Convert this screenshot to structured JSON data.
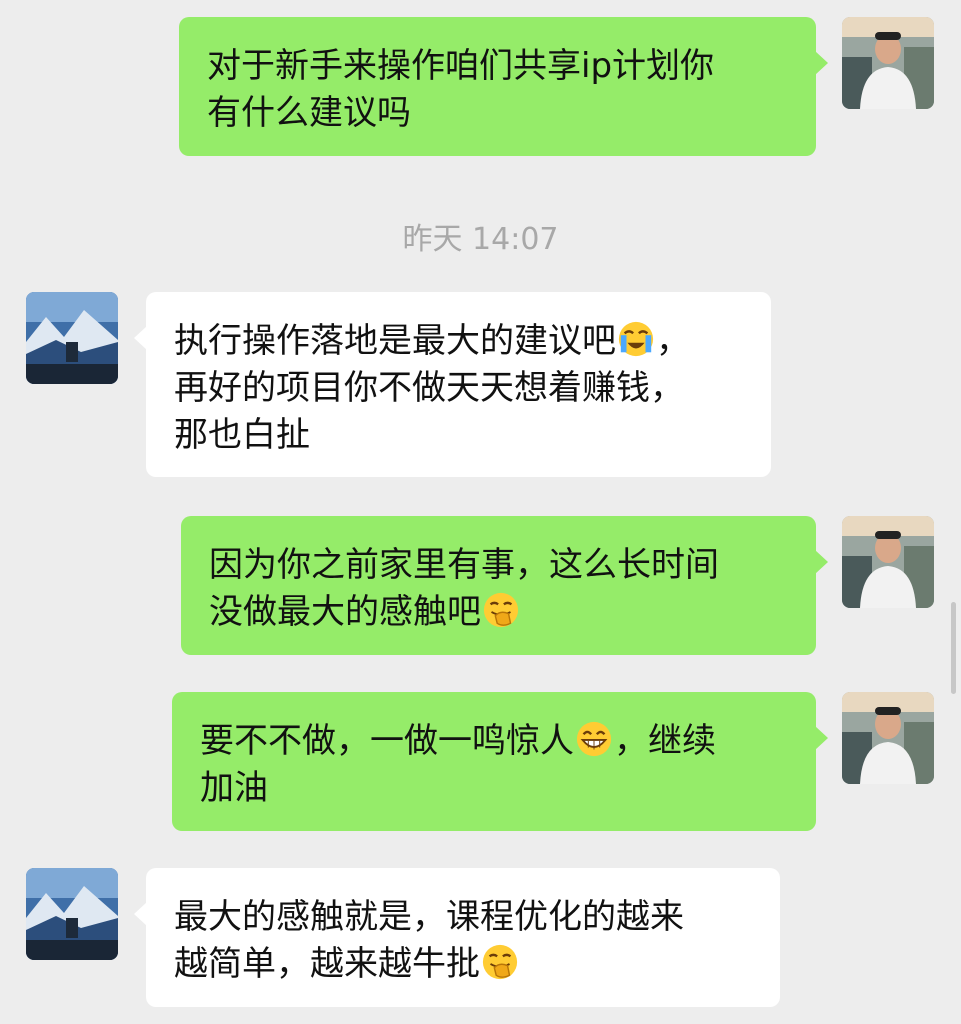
{
  "timestamp": "昨天 14:07",
  "messages": [
    {
      "side": "right",
      "lines": [
        "对于新手来操作咱们共享ip计划你",
        "有什么建议吗"
      ]
    },
    {
      "side": "left",
      "lines": [
        "执行操作落地是最大的建议吧",
        "，",
        "再好的项目你不做天天想着赚钱，",
        "那也白扯"
      ],
      "emoji": "loudly-crying-face"
    },
    {
      "side": "right",
      "lines": [
        "因为你之前家里有事，这么长时间",
        "没做最大的感触吧"
      ],
      "emoji": "face-with-hand-over-mouth"
    },
    {
      "side": "right",
      "lines": [
        "要不不做，一做一鸣惊人",
        "，继续",
        "加油"
      ],
      "emoji": "grinning-face-with-smiling-eyes"
    },
    {
      "side": "left",
      "lines": [
        "最大的感触就是，课程优化的越来",
        "越简单，越来越牛批"
      ],
      "emoji": "face-with-hand-over-mouth"
    }
  ]
}
